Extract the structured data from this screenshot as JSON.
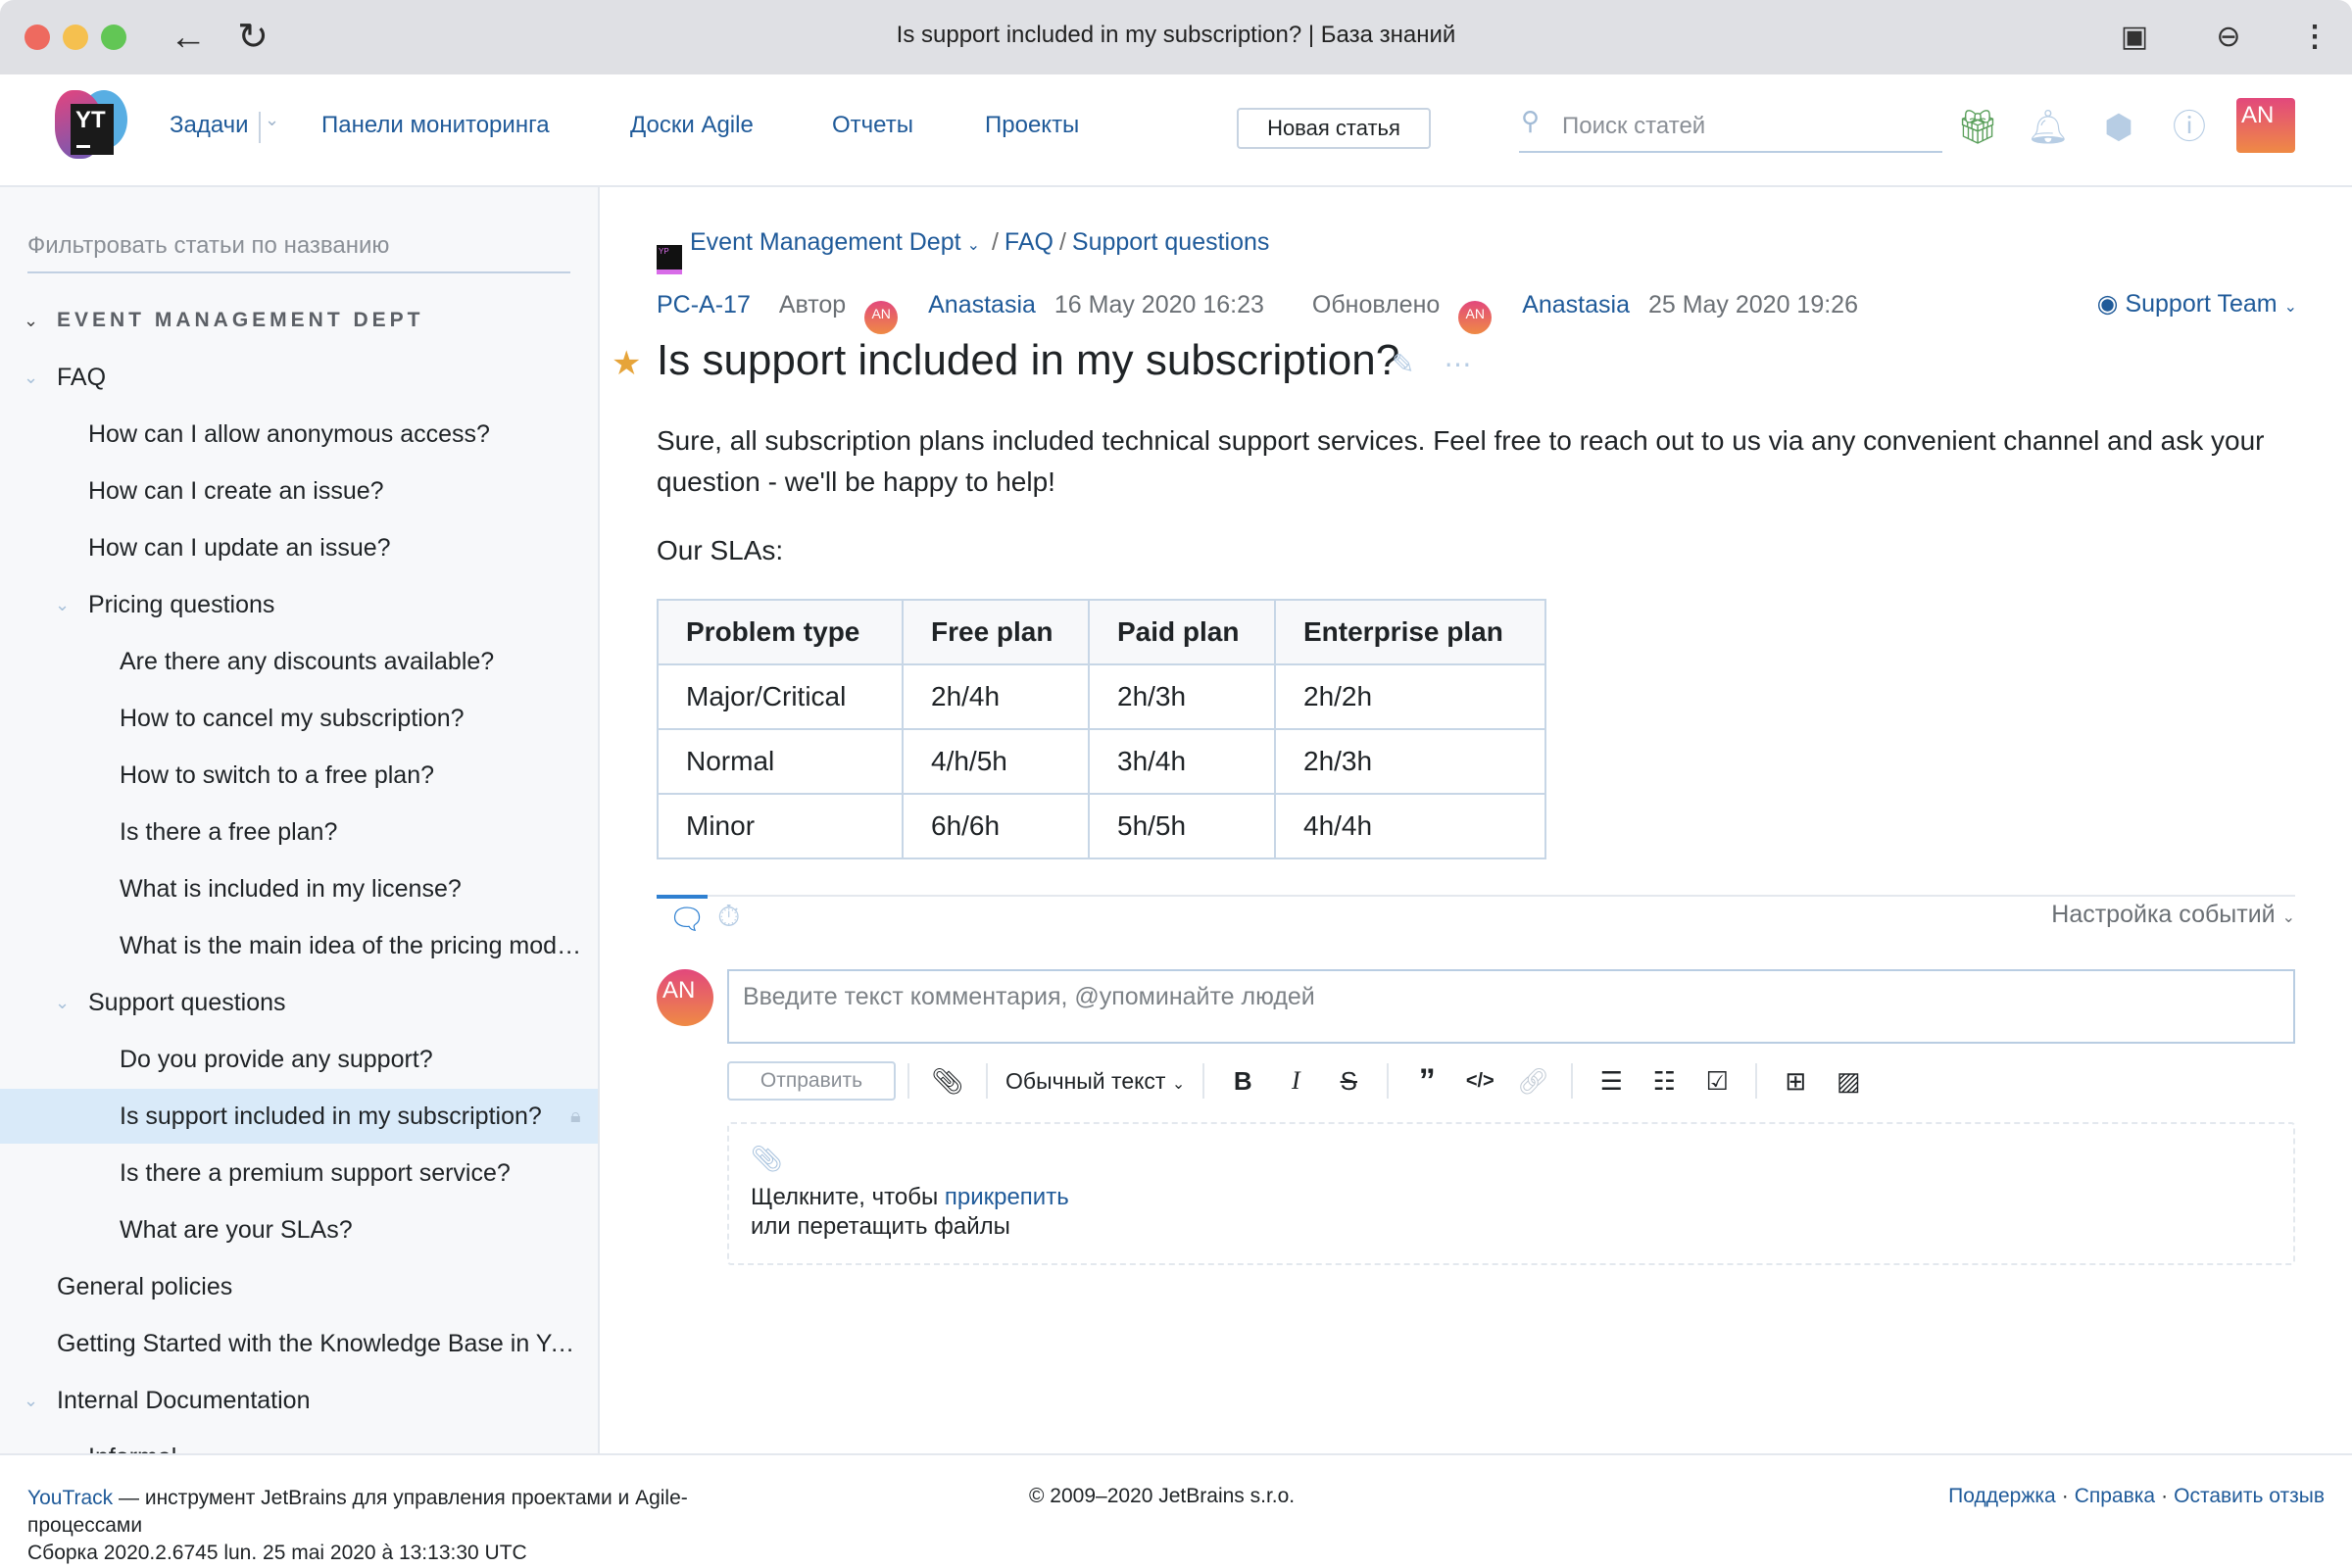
{
  "browser": {
    "tab_title": "Is support included in my subscription? | База знаний"
  },
  "topbar": {
    "nav": [
      "Задачи",
      "Панели мониторинга",
      "Доски Agile",
      "Отчеты",
      "Проекты"
    ],
    "new_article": "Новая статья",
    "search_placeholder": "Поиск статей",
    "user_initials": "AN"
  },
  "sidebar": {
    "filter_placeholder": "Фильтровать статьи по названию",
    "tree": [
      {
        "label": "EVENT MANAGEMENT DEPT",
        "level": 0,
        "expanded": true,
        "section": true
      },
      {
        "label": "FAQ",
        "level": 1,
        "expanded": true
      },
      {
        "label": "How can I allow anonymous access?",
        "level": 2
      },
      {
        "label": "How can I create an issue?",
        "level": 2
      },
      {
        "label": "How can I update an issue?",
        "level": 2
      },
      {
        "label": "Pricing questions",
        "level": 2,
        "expanded": true
      },
      {
        "label": "Are there any discounts available?",
        "level": 3
      },
      {
        "label": "How to cancel my subscription?",
        "level": 3
      },
      {
        "label": "How to switch to a free plan?",
        "level": 3
      },
      {
        "label": "Is there a free plan?",
        "level": 3
      },
      {
        "label": "What is included in my license?",
        "level": 3
      },
      {
        "label": "What is the main idea of the pricing model?",
        "level": 3
      },
      {
        "label": "Support questions",
        "level": 2,
        "expanded": true
      },
      {
        "label": "Do you provide any support?",
        "level": 3
      },
      {
        "label": "Is support included in my subscription?",
        "level": 3,
        "selected": true,
        "locked": true
      },
      {
        "label": "Is there a premium support service?",
        "level": 3
      },
      {
        "label": "What are your SLAs?",
        "level": 3
      },
      {
        "label": "General policies",
        "level": 1
      },
      {
        "label": "Getting Started with the Knowledge Base in YouTrack",
        "level": 1
      },
      {
        "label": "Internal Documentation",
        "level": 1,
        "expanded": true
      },
      {
        "label": "Informal",
        "level": 2,
        "expanded": true
      }
    ]
  },
  "article": {
    "breadcrumb": {
      "project": "Event Management Dept",
      "path": [
        "FAQ",
        "Support questions"
      ]
    },
    "id": "PC-A-17",
    "author_label": "Автор",
    "author": "Anastasia",
    "created": "16 May 2020 16:23",
    "updated_label": "Обновлено",
    "updated_by": "Anastasia",
    "updated": "25 May 2020 19:26",
    "avatar_initials": "AN",
    "visibility": "Support Team",
    "title": "Is support included in my subscription?",
    "paragraph": "Sure, all subscription plans included technical support services. Feel free to reach out to us via any convenient channel and ask your question - we'll be happy to help!",
    "sla_heading": "Our SLAs:",
    "table": {
      "headers": [
        "Problem type",
        "Free plan",
        "Paid plan",
        "Enterprise plan"
      ],
      "rows": [
        [
          "Major/Critical",
          "2h/4h",
          "2h/3h",
          "2h/2h"
        ],
        [
          "Normal",
          "4/h/5h",
          "3h/4h",
          "2h/3h"
        ],
        [
          "Minor",
          "6h/6h",
          "5h/5h",
          "4h/4h"
        ]
      ]
    }
  },
  "activity": {
    "events_settings": "Настройка событий",
    "comment_placeholder": "Введите текст комментария, @упоминайте людей",
    "send_label": "Отправить",
    "format_label": "Обычный текст",
    "attach_text_1": "Щелкните, чтобы ",
    "attach_link": "прикрепить",
    "attach_text_2": "или перетащить файлы"
  },
  "footer": {
    "brand_link": "YouTrack",
    "brand_text": " — инструмент JetBrains для управления проектами и Agile-процессами",
    "build": "Сборка 2020.2.6745 lun. 25 mai 2020 à 13:13:30 UTC",
    "copyright": "© 2009–2020 JetBrains s.r.o.",
    "links": [
      "Поддержка",
      "Справка",
      "Оставить отзыв"
    ]
  }
}
